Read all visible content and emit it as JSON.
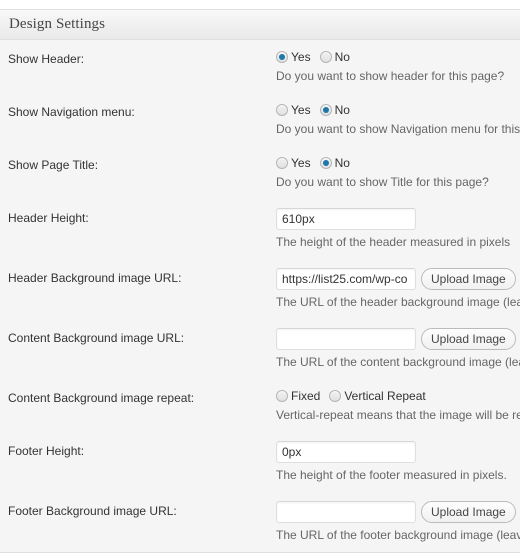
{
  "panel": {
    "title": "Design Settings"
  },
  "colors": {
    "panel_bg": "#f5f5f5",
    "panel_border": "#dfdfdf",
    "radio_accent": "#1e77ab",
    "label_text": "#333333",
    "desc_text": "#666666"
  },
  "common": {
    "yes_label": "Yes",
    "no_label": "No",
    "upload_button_label": "Upload Image",
    "url_placeholder": ""
  },
  "rows": [
    {
      "id": "show-header",
      "label": "Show Header:",
      "type": "radio",
      "options": [
        {
          "label": "Yes",
          "checked": true
        },
        {
          "label": "No",
          "checked": false
        }
      ],
      "description": "Do you want to show header for this page?"
    },
    {
      "id": "show-navigation-menu",
      "label": "Show Navigation menu:",
      "type": "radio",
      "options": [
        {
          "label": "Yes",
          "checked": false
        },
        {
          "label": "No",
          "checked": true
        }
      ],
      "description": "Do you want to show Navigation menu for this page?"
    },
    {
      "id": "show-page-title",
      "label": "Show Page Title:",
      "type": "radio",
      "options": [
        {
          "label": "Yes",
          "checked": false
        },
        {
          "label": "No",
          "checked": true
        }
      ],
      "description": "Do you want to show Title for this page?"
    },
    {
      "id": "header-height",
      "label": "Header Height:",
      "type": "text",
      "value": "610px",
      "description": "The height of the header measured in pixels"
    },
    {
      "id": "header-background-image-url",
      "label": "Header Background image URL:",
      "type": "text-upload",
      "value": "https://list25.com/wp-co",
      "button_label": "Upload Image",
      "description": "The URL of the header background image (leave blank for none)"
    },
    {
      "id": "content-background-image-url",
      "label": "Content Background image URL:",
      "type": "text-upload",
      "value": "",
      "button_label": "Upload Image",
      "description": "The URL of the content background image (leave blank for none)"
    },
    {
      "id": "content-background-image-repeat",
      "label": "Content Background image repeat:",
      "type": "radio",
      "options": [
        {
          "label": "Fixed",
          "checked": false
        },
        {
          "label": "Vertical Repeat",
          "checked": false
        }
      ],
      "description": "Vertical-repeat means that the image will be repeated"
    },
    {
      "id": "footer-height",
      "label": "Footer Height:",
      "type": "text",
      "value": "0px",
      "description": "The height of the footer measured in pixels."
    },
    {
      "id": "footer-background-image-url",
      "label": "Footer Background image URL:",
      "type": "text-upload",
      "value": "",
      "button_label": "Upload Image",
      "description": "The URL of the footer background image (leave blank for none)"
    }
  ]
}
